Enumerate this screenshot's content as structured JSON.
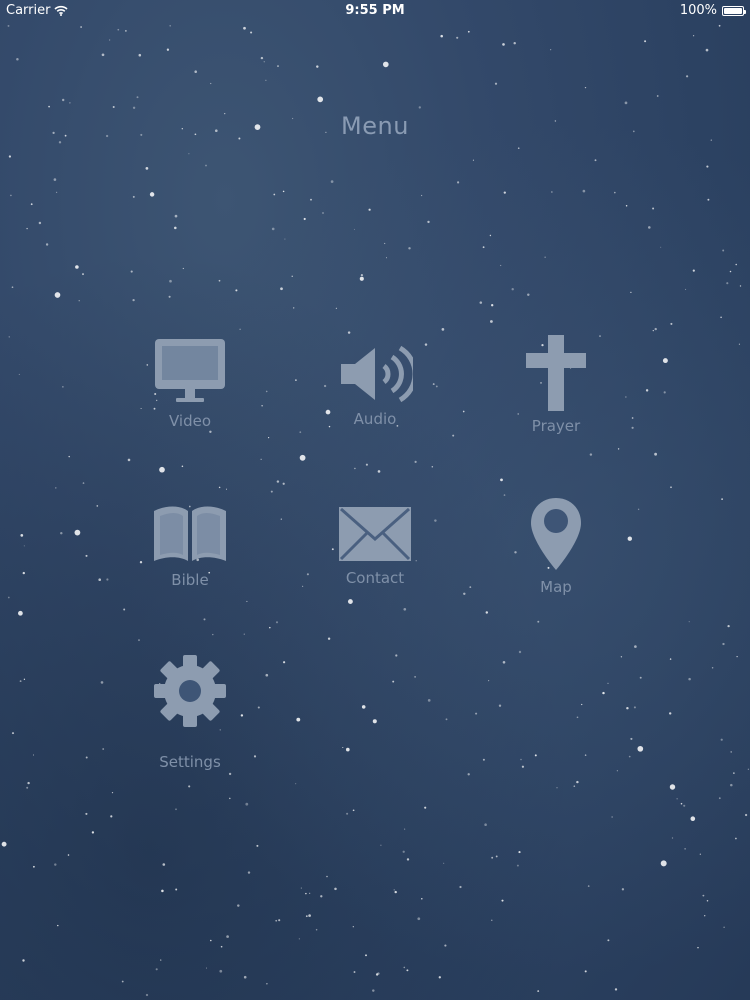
{
  "status_bar": {
    "carrier": "Carrier",
    "time": "9:55 PM",
    "battery_percent": "100%",
    "battery_level": 1.0
  },
  "title": "Menu",
  "menu": {
    "video": {
      "label": "Video",
      "icon": "monitor-icon"
    },
    "audio": {
      "label": "Audio",
      "icon": "speaker-icon"
    },
    "prayer": {
      "label": "Prayer",
      "icon": "cross-icon"
    },
    "bible": {
      "label": "Bible",
      "icon": "open-book-icon"
    },
    "contact": {
      "label": "Contact",
      "icon": "envelope-icon"
    },
    "map": {
      "label": "Map",
      "icon": "map-pin-icon"
    },
    "settings": {
      "label": "Settings",
      "icon": "gear-icon"
    }
  },
  "colors": {
    "background": "#33496a",
    "icon": "#8d9cb0",
    "label": "#7f90a8"
  }
}
